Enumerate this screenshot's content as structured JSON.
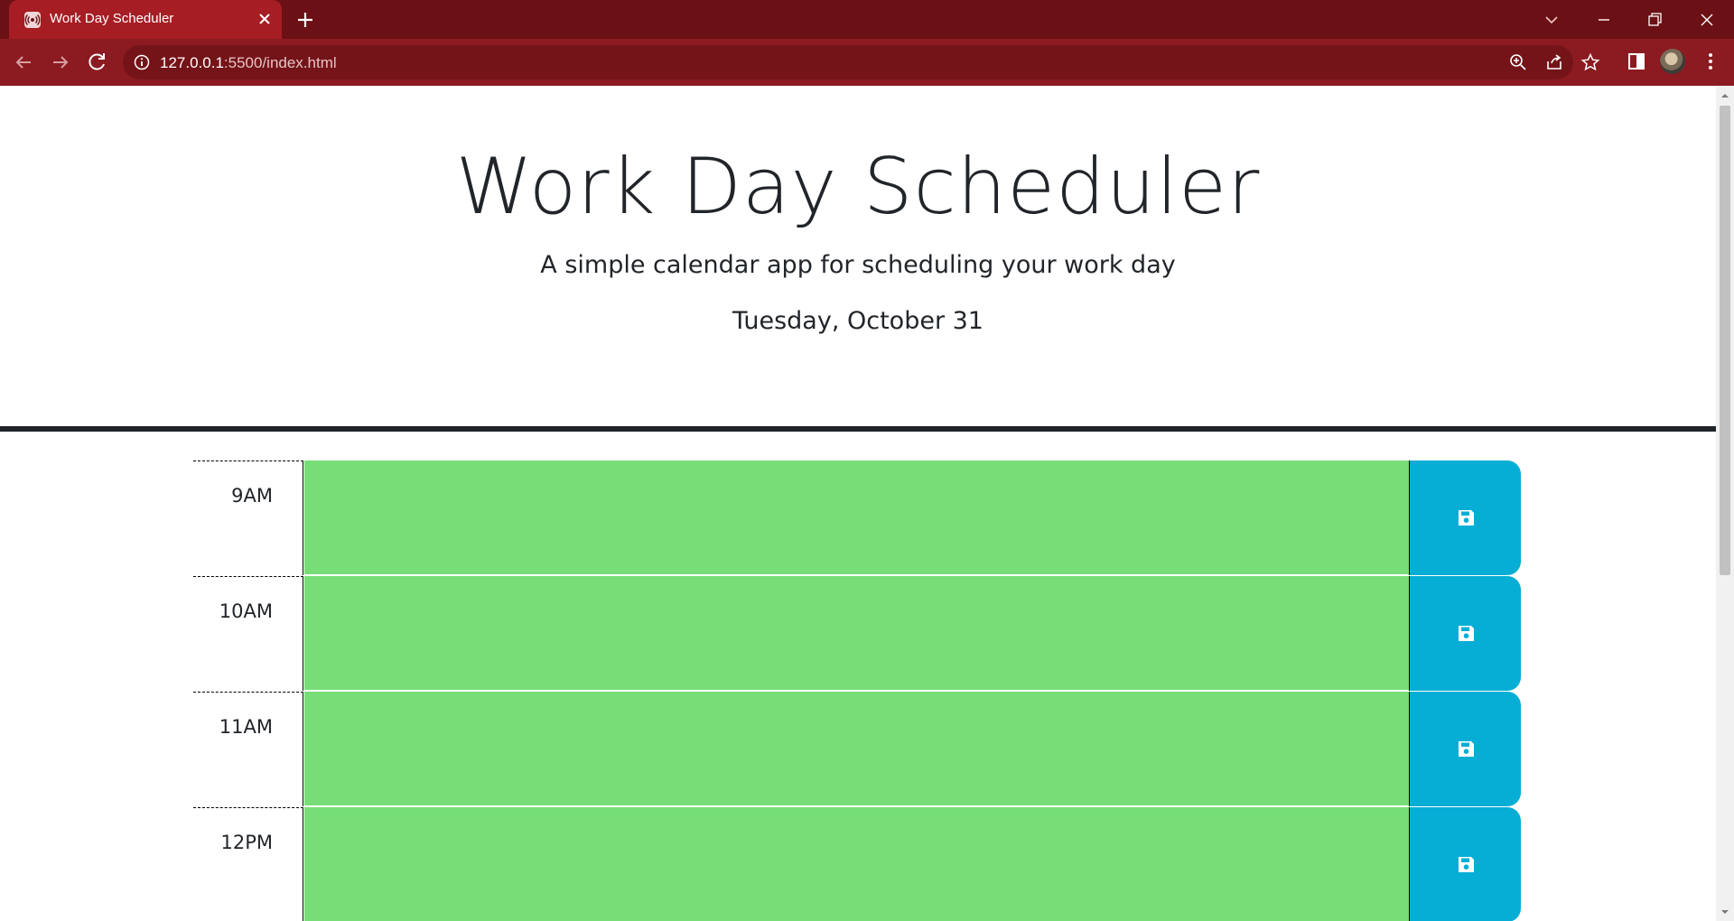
{
  "browser": {
    "tab": {
      "title": "Work Day Scheduler",
      "favicon": "broadcast-icon"
    },
    "url": {
      "host": "127.0.0.1",
      "rest": ":5500/index.html"
    },
    "colors": {
      "tabbar": "#6b1014",
      "active_tab": "#a61d24",
      "toolbar": "#8b1b21"
    }
  },
  "header": {
    "title": "Work Day Scheduler",
    "lead": "A simple calendar app for scheduling your work day",
    "current_day": "Tuesday, October 31"
  },
  "timeblocks": [
    {
      "hour": "9AM",
      "text": "",
      "state": "future"
    },
    {
      "hour": "10AM",
      "text": "",
      "state": "future"
    },
    {
      "hour": "11AM",
      "text": "",
      "state": "future"
    },
    {
      "hour": "12PM",
      "text": "",
      "state": "future"
    }
  ],
  "colors": {
    "future": "#77dd77",
    "save_button": "#06aed5",
    "save_icon": "save-icon"
  }
}
